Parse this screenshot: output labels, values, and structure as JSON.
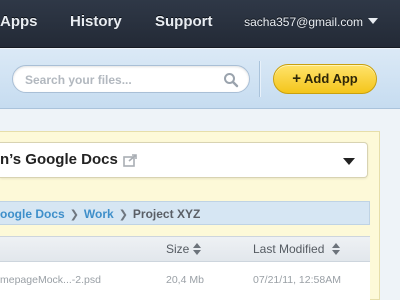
{
  "nav": {
    "links": [
      "Apps",
      "History",
      "Support"
    ],
    "account_email": "sacha357@gmail.com"
  },
  "toolbar": {
    "search_placeholder": "Search your files...",
    "add_app_label": "Add App"
  },
  "folder": {
    "title": "n’s Google Docs"
  },
  "breadcrumb": {
    "items": [
      "oogle Docs",
      "Work",
      "Project XYZ"
    ]
  },
  "table": {
    "columns": [
      "Size",
      "Last Modified"
    ],
    "rows": [
      {
        "name": "mepageMock...-2.psd",
        "size": "20,4 Mb",
        "modified": "07/21/11, 12:58AM"
      }
    ]
  },
  "colors": {
    "nav_bg": "#2a323f",
    "toolbar_bg": "#cfe2f3",
    "accent_yellow": "#f9d43a",
    "link_blue": "#3e8fca"
  },
  "icons": [
    "search-icon",
    "plus-icon",
    "share-icon",
    "dropdown-caret-icon",
    "chevron-right-icon",
    "sort-icon"
  ]
}
